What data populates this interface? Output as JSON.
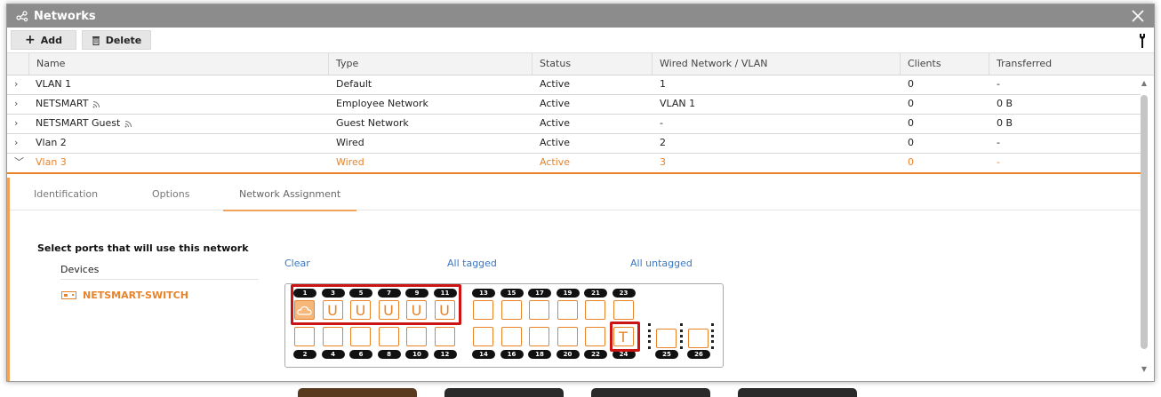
{
  "window": {
    "title": "Networks"
  },
  "toolbar": {
    "add_label": "Add",
    "delete_label": "Delete"
  },
  "table": {
    "columns": [
      "Name",
      "Type",
      "Status",
      "Wired Network / VLAN",
      "Clients",
      "Transferred"
    ],
    "rows": [
      {
        "name": "VLAN 1",
        "type": "Default",
        "status": "Active",
        "vlan": "1",
        "clients": "0",
        "transferred": "-",
        "wifi": false
      },
      {
        "name": "NETSMART",
        "type": "Employee Network",
        "status": "Active",
        "vlan": "VLAN 1",
        "clients": "0",
        "transferred": "0 B",
        "wifi": true
      },
      {
        "name": "NETSMART Guest",
        "type": "Guest Network",
        "status": "Active",
        "vlan": "-",
        "clients": "0",
        "transferred": "0 B",
        "wifi": true
      },
      {
        "name": "Vlan 2",
        "type": "Wired",
        "status": "Active",
        "vlan": "2",
        "clients": "0",
        "transferred": "-",
        "wifi": false
      },
      {
        "name": "Vlan 3",
        "type": "Wired",
        "status": "Active",
        "vlan": "3",
        "clients": "0",
        "transferred": "-",
        "wifi": false
      }
    ]
  },
  "detail": {
    "tabs": [
      "Identification",
      "Options",
      "Network Assignment"
    ],
    "active_tab": "Network Assignment",
    "section_title": "Select ports that will use this network",
    "devices_label": "Devices",
    "device_name": "NETSMART-SWITCH",
    "actions": {
      "clear": "Clear",
      "all_tagged": "All tagged",
      "all_untagged": "All untagged"
    },
    "ports": {
      "top_labels": [
        "1",
        "3",
        "5",
        "7",
        "9",
        "11",
        "13",
        "15",
        "17",
        "19",
        "21",
        "23"
      ],
      "top_states": [
        "uplink",
        "U",
        "U",
        "U",
        "U",
        "U",
        "",
        "",
        "",
        "",
        "",
        ""
      ],
      "bottom_labels": [
        "2",
        "4",
        "6",
        "8",
        "10",
        "12",
        "14",
        "16",
        "18",
        "20",
        "22",
        "24"
      ],
      "bottom_states": [
        "",
        "",
        "",
        "",
        "",
        "",
        "",
        "",
        "",
        "",
        "",
        "T"
      ],
      "sfp_labels": [
        "25",
        "26"
      ]
    }
  },
  "colors": {
    "accent": "#e8832a",
    "link": "#3877c6",
    "highlight": "#cc1414",
    "titlebar": "#8c8c8c"
  }
}
